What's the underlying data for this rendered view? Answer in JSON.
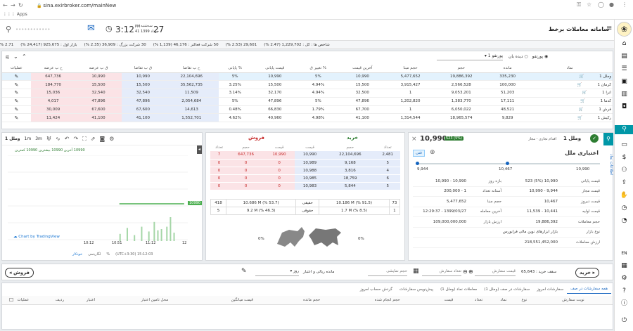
{
  "browser": {
    "url": "sina.exirbroker.com/mainNew",
    "apps_label": "Apps"
  },
  "header": {
    "app_title": "سامانه معاملات برخط",
    "date_day": "27",
    "weekday": "سه‌شنبه",
    "month_year": "خرداد 1399",
    "time": "3:12",
    "seconds": "PM",
    "seconds_val": "41",
    "user_name": "••••••••••••"
  },
  "ticker": {
    "items": [
      "شاخص ها : کل : 1,229,702 (2.47 %)",
      "29,601 (2.53 %)",
      "50 شرکت فعالتر : 46,176 (1,139 %)",
      "30 شرکت بزرگ : 36,909 (2.35 %)",
      "بازار اول : 925,675 (24,417 %)",
      "2.71 %"
    ]
  },
  "watchlist": {
    "radio_portfolio": "پورتفو",
    "radio_watch": "دیده بان",
    "select_value": "پورتفو 1",
    "columns": [
      "نماد",
      "مانده",
      "حجم",
      "حجم مبنا",
      "آخرین قیمت",
      "% تغییر ق",
      "قیمت پایانی",
      "% پایانی",
      "ح ب تقاضا",
      "ق ب تقاضا",
      "ق ب عرضه",
      "ح ب عرضه",
      "عملیات"
    ],
    "rows": [
      [
        "وملل 1",
        "335,230",
        "19,886,392",
        "5,477,652",
        "10,990",
        "5%",
        "10,990",
        "5%",
        "22,104,696",
        "10,990",
        "10,990",
        "647,736"
      ],
      [
        "کرمان 1",
        "100,000",
        "2,566,528",
        "3,915,427",
        "15,500",
        "4.94%",
        "15,500",
        "3.25%",
        "35,562,735",
        "15,500",
        "15,500",
        "184,770"
      ],
      [
        "انرا 1",
        "51,203",
        "9,053,201",
        "1",
        "32,500",
        "4.94%",
        "32,170",
        "3.14%",
        "11,509",
        "32,540",
        "32,540",
        "15,036"
      ],
      [
        "کدما 1",
        "17,111",
        "1,383,770",
        "1,202,820",
        "47,896",
        "5%",
        "47,896",
        "5%",
        "2,054,684",
        "47,896",
        "47,896",
        "4,017"
      ],
      [
        "فرش 1",
        "48,521",
        "6,050,022",
        "1",
        "67,700",
        "1.79%",
        "66,830",
        "0.48%",
        "14,613",
        "67,600",
        "67,600",
        "30,009"
      ],
      [
        "رکیش 1",
        "9,829",
        "18,965,574",
        "1,314,544",
        "41,100",
        "4.98%",
        "40,960",
        "4.62%",
        "1,552,701",
        "41,100",
        "41,100",
        "11,424"
      ]
    ]
  },
  "chart": {
    "symbol": "وملل 1",
    "interval": "3m",
    "interval2": "1m",
    "legend": "10990 آخرین 10990 بیشترین 10990 کمترین",
    "price_tag": "10990",
    "attribution": "Chart by TradingView",
    "x_labels": [
      "10:12",
      "10:51",
      "11:12",
      "12"
    ],
    "footer_time": "(UTC+3:30) 15:12:03",
    "footer_opts": [
      "%",
      "لگاریتمی",
      "خودکار"
    ],
    "volume_bars": [
      {
        "t": 0.62,
        "v": 0.3
      },
      {
        "t": 0.66,
        "v": 0.55
      },
      {
        "t": 0.7,
        "v": 0.25
      },
      {
        "t": 0.74,
        "v": 0.6
      },
      {
        "t": 0.78,
        "v": 0.4
      },
      {
        "t": 0.81,
        "v": 0.8
      },
      {
        "t": 0.83,
        "v": 0.45
      },
      {
        "t": 0.85,
        "v": 0.5
      },
      {
        "t": 0.88,
        "v": 0.6
      },
      {
        "t": 0.9,
        "v": 1.0
      },
      {
        "t": 0.92,
        "v": 0.35
      }
    ],
    "price_series": [
      0.62,
      0.98
    ]
  },
  "orderbook": {
    "buy_title": "خرید",
    "sell_title": "فروش",
    "headers": [
      "تعداد",
      "حجم",
      "قیمت",
      "قیمت",
      "حجم",
      "تعداد"
    ],
    "rows": [
      [
        "2,481",
        "22,104,696",
        "10,990",
        "10,990",
        "647,736",
        "7"
      ],
      [
        "5",
        "9,168",
        "10,989",
        "0",
        "0",
        "0"
      ],
      [
        "4",
        "3,816",
        "10,988",
        "0",
        "0",
        "0"
      ],
      [
        "6",
        "18,759",
        "10,985",
        "0",
        "0",
        "0"
      ],
      [
        "5",
        "5,844",
        "10,983",
        "0",
        "0",
        "0"
      ]
    ],
    "summary": [
      [
        "73",
        "10.186 M (% 91.5)",
        "حقیقی",
        "10.686 M (% 53.7)",
        "418"
      ],
      [
        "1",
        "1.7 M (% 8.5)",
        "حقوقی",
        "9.2 M (% 46.3)",
        "5"
      ]
    ],
    "pct_left": "0%",
    "pct_right": "0%"
  },
  "info": {
    "symbol": "وملل 1",
    "subtitle": "اقدام تجاری - مجاز",
    "price": "10,990",
    "badge": "523 (5%)",
    "company": "اعتباری ملل",
    "tag": "فنی",
    "range_low": "9,944",
    "range_mid": "10,467",
    "range_high": "10,990",
    "side_tab": "اطلاعات نماد",
    "fields": [
      [
        "قیمت پایانی",
        "10,990 (5%) 523",
        "بازه روز",
        "10,990 - 10,990"
      ],
      [
        "قیمت مجاز",
        "9,944 - 10,990",
        "آستانه تعداد",
        "1 - 200,000"
      ],
      [
        "قیمت دیروز",
        "10,467",
        "حجم مبنا",
        "5,477,652"
      ],
      [
        "قیمت اولیه",
        "10,441 - 11,539",
        "آخرین معامله",
        "1399/03/27 - 12:29:37"
      ],
      [
        "حجم معاملات",
        "19,886,392",
        "ارزش بازار",
        "109,000,000,000"
      ],
      [
        "نوع بازار",
        "بازار ابزارهای نوین مالی فرابورس",
        "",
        ""
      ],
      [
        "ارزش معاملات",
        "218,551,452,000",
        "",
        ""
      ]
    ]
  },
  "orderbar": {
    "buy_label": "خرید",
    "sell_label": "فروش",
    "credit_label": "سقف خرید : 65,643",
    "price_label": "قیمت سفارش",
    "qty_label": "تعداد سفارش",
    "min_qty": "حجم نمایشی",
    "validity": "روز",
    "validity_label": "مانده ریالی و اعتبار"
  },
  "orders": {
    "tabs": [
      "همه سفارشات در صف",
      "سفارشات امروز",
      "سفارشات در صف (وملل 1)",
      "معاملات نماد (وملل 1)",
      "پیش‌نویس سفارشات",
      "گردش حساب امروز"
    ],
    "columns": [
      "نوبت سفارش",
      "نوع",
      "نماد",
      "تعداد",
      "قیمت",
      "حجم انجام شده",
      "حجم مانده",
      "قیمت میانگین",
      "محل تامین اعتبار",
      "اعتبار",
      "ردیف",
      "عملیات"
    ]
  },
  "sidebar": {
    "items": [
      "home-icon",
      "portfolio-icon",
      "list-icon",
      "briefcase-icon",
      "chart-icon",
      "id-card-icon",
      "dollar-icon",
      "users-icon",
      "upload-icon",
      "hand-icon",
      "clock-icon"
    ],
    "bottom": [
      "EN",
      "grid-icon",
      "gear-icon",
      "help-icon",
      "power-icon"
    ]
  },
  "colors": {
    "accent": "#0097a7",
    "buy": "#2e7d32",
    "sell": "#c62828",
    "bid_bg": "#fbe3e6",
    "ask_bg": "#e5ecfa",
    "brand": "#1565c0"
  }
}
